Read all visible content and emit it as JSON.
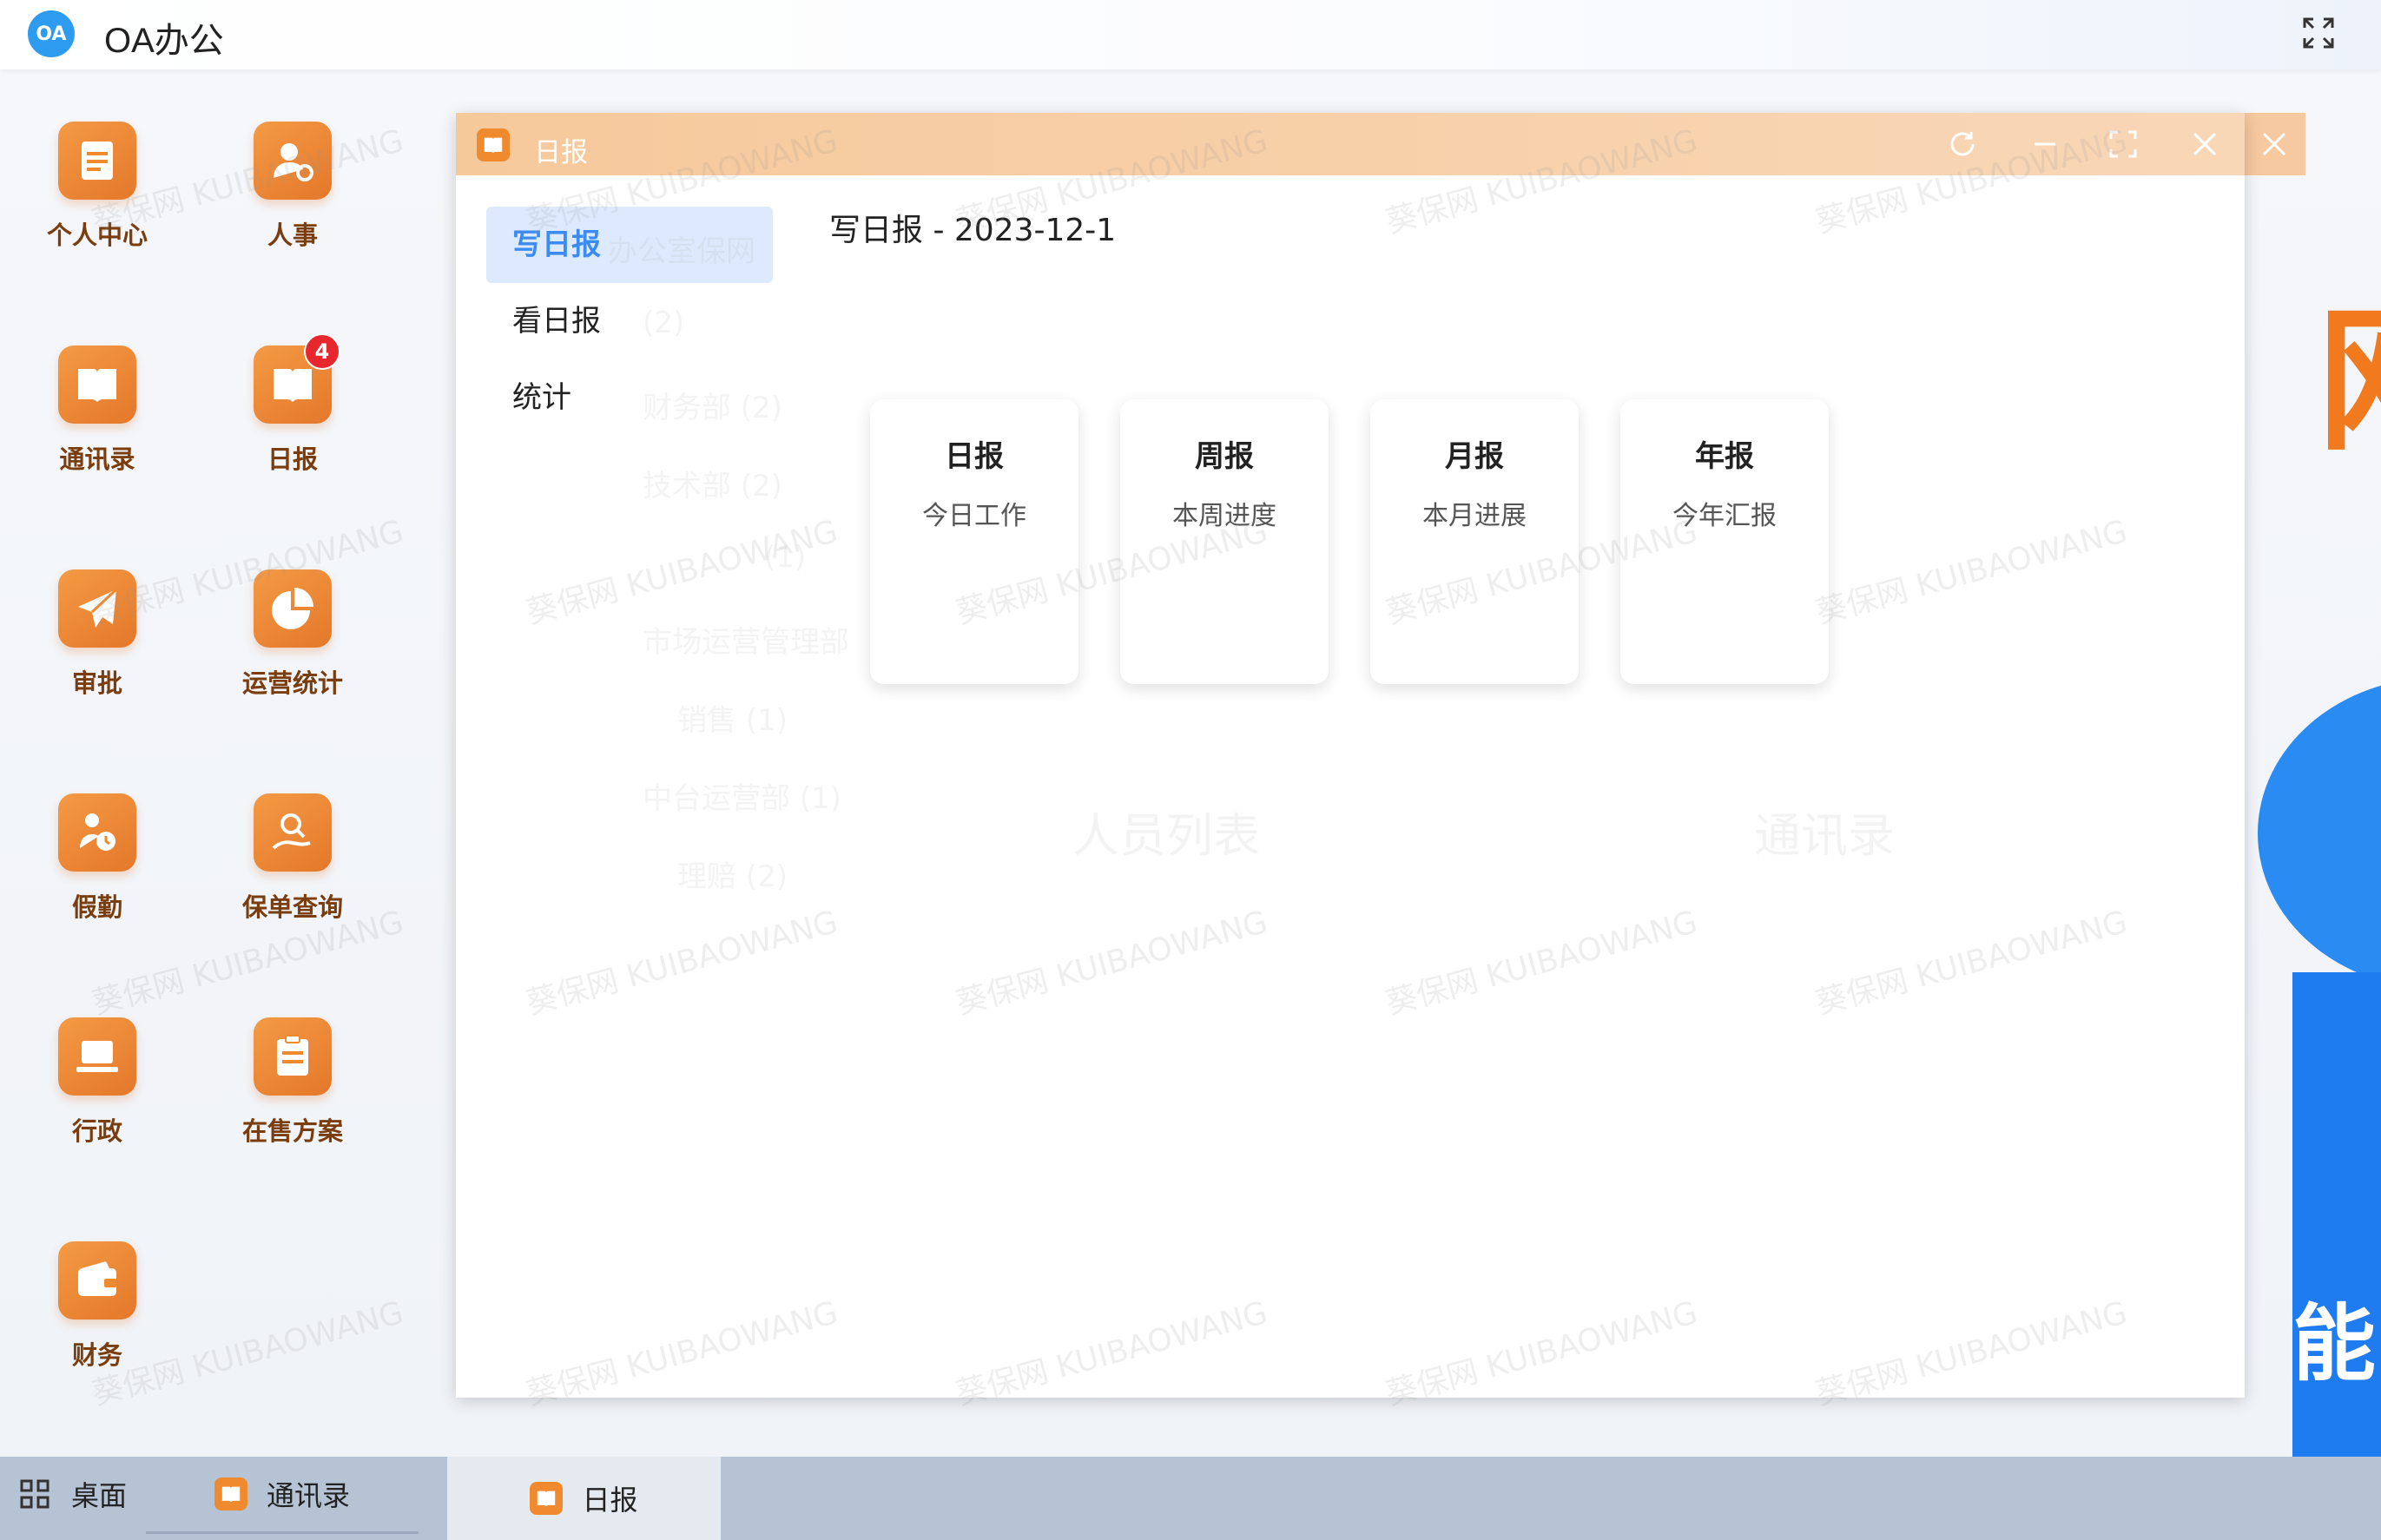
{
  "app": {
    "title": "OA办公",
    "logo_text": "OA"
  },
  "desktop": {
    "icons": [
      {
        "label": "个人中心",
        "icon": "document-icon"
      },
      {
        "label": "人事",
        "icon": "user-gear-icon"
      },
      {
        "label": "通讯录",
        "icon": "book-icon"
      },
      {
        "label": "日报",
        "icon": "book-icon",
        "badge": "4"
      },
      {
        "label": "审批",
        "icon": "paper-plane-icon"
      },
      {
        "label": "运营统计",
        "icon": "pie-chart-icon"
      },
      {
        "label": "假勤",
        "icon": "person-clock-icon"
      },
      {
        "label": "保单查询",
        "icon": "search-user-icon"
      },
      {
        "label": "行政",
        "icon": "laptop-icon"
      },
      {
        "label": "在售方案",
        "icon": "clipboard-icon"
      },
      {
        "label": "财务",
        "icon": "wallet-icon"
      }
    ]
  },
  "window": {
    "title": "日报",
    "nav": [
      "写日报",
      "看日报",
      "统计"
    ],
    "active_nav": "写日报",
    "content_title": "写日报 - 2023-12-1",
    "cards": [
      {
        "title": "日报",
        "subtitle": "今日工作"
      },
      {
        "title": "周报",
        "subtitle": "本周进度"
      },
      {
        "title": "月报",
        "subtitle": "本月进展"
      },
      {
        "title": "年报",
        "subtitle": "今年汇报"
      }
    ]
  },
  "watermark": {
    "text": "葵保网 KUIBAOWANG"
  },
  "background_text": {
    "ghost_tree": [
      "(2)",
      "财务部 (2)",
      "技术部 (2)",
      "(1)",
      "市场运营管理部",
      "销售 (1)",
      "中台运营部 (1)",
      "理赔 (2)"
    ],
    "ghost_nav": "办公室保网",
    "ghost_labels": [
      "人员列表",
      "通讯录"
    ],
    "big_char_a": "网",
    "big_char_b": "能"
  },
  "taskbar": {
    "items": [
      {
        "label": "桌面",
        "icon": "grid-icon"
      },
      {
        "label": "通讯录",
        "icon": "book-icon"
      },
      {
        "label": "日报",
        "icon": "book-icon",
        "active": true
      }
    ]
  },
  "colors": {
    "accent_orange": "#F08A2E",
    "active_nav_bg": "#DDEAFD",
    "active_nav_text": "#3B8BF0",
    "badge_red": "#E8262D",
    "taskbar_bg": "#B6C3D4"
  }
}
